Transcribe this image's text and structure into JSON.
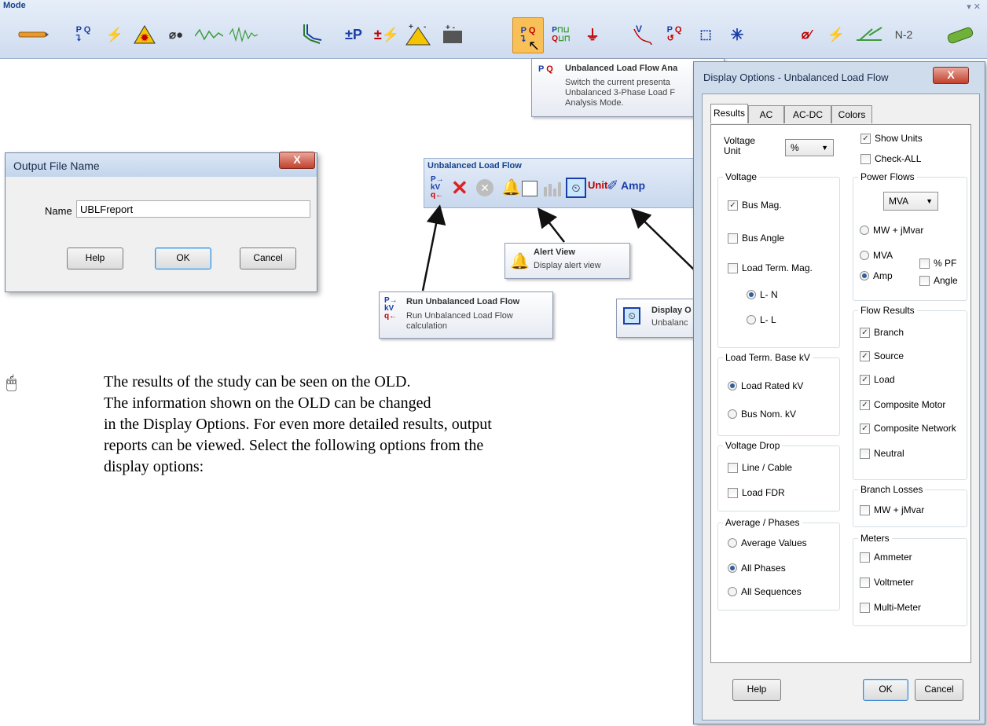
{
  "mode_bar": {
    "title": "Mode",
    "pin_glyph": "▾ ✕",
    "n2_label": "N-2"
  },
  "tooltip_ulf": {
    "title": "Unbalanced Load Flow Ana",
    "desc1": "Switch the current presenta",
    "desc2": "Unbalanced 3-Phase Load F",
    "desc3": "Analysis Mode."
  },
  "output_dialog": {
    "title": "Output File Name",
    "close": "X",
    "name_label": "Name",
    "name_value": "UBLFreport",
    "help": "Help",
    "ok": "OK",
    "cancel": "Cancel"
  },
  "ulf_toolbar": {
    "title": "Unbalanced Load Flow",
    "unit_label": "Unit",
    "amp_label": "Amp"
  },
  "callouts": {
    "alert_title": "Alert View",
    "alert_desc": "Display alert view",
    "run_title": "Run Unbalanced Load Flow",
    "run_desc1": "Run Unbalanced Load Flow",
    "run_desc2": "calculation",
    "disp_title": "Display O",
    "disp_desc": "Unbalanc"
  },
  "body_text": {
    "line1": "The results of the study can be seen on the OLD.",
    "line2": "The information shown on the OLD can be changed",
    "line3": "in the Display Options. For even more detailed results, output",
    "line4": "reports can be viewed. Select the following options from the",
    "line5": "display options:"
  },
  "display_dialog": {
    "title": "Display Options - Unbalanced Load Flow",
    "close": "X",
    "tabs": [
      "Results",
      "AC",
      "AC-DC",
      "Colors"
    ],
    "voltage_unit_label1": "Voltage",
    "voltage_unit_label2": "Unit",
    "voltage_unit_value": "%",
    "show_units": "Show Units",
    "check_all": "Check-ALL",
    "voltage_group": "Voltage",
    "bus_mag": "Bus Mag.",
    "bus_angle": "Bus Angle",
    "load_term_mag": "Load Term. Mag.",
    "ln": "L- N",
    "ll": "L- L",
    "power_flows_group": "Power Flows",
    "power_flows_value": "MVA",
    "mw_jmvar": "MW + jMvar",
    "mva": "MVA",
    "amp": "Amp",
    "pct_pf": "% PF",
    "angle": "Angle",
    "load_term_base_group": "Load Term. Base kV",
    "load_rated_kv": "Load Rated kV",
    "bus_nom_kv": "Bus Nom. kV",
    "flow_results_group": "Flow Results",
    "branch": "Branch",
    "source": "Source",
    "load": "Load",
    "composite_motor": "Composite Motor",
    "composite_network": "Composite Network",
    "neutral": "Neutral",
    "voltage_drop_group": "Voltage Drop",
    "line_cable": "Line / Cable",
    "load_fdr": "Load FDR",
    "branch_losses_group": "Branch Losses",
    "bl_mw_jmvar": "MW + jMvar",
    "avg_phases_group": "Average / Phases",
    "average_values": "Average Values",
    "all_phases": "All Phases",
    "all_sequences": "All Sequences",
    "meters_group": "Meters",
    "ammeter": "Ammeter",
    "voltmeter": "Voltmeter",
    "multi_meter": "Multi-Meter",
    "help": "Help",
    "ok": "OK",
    "cancel": "Cancel"
  }
}
